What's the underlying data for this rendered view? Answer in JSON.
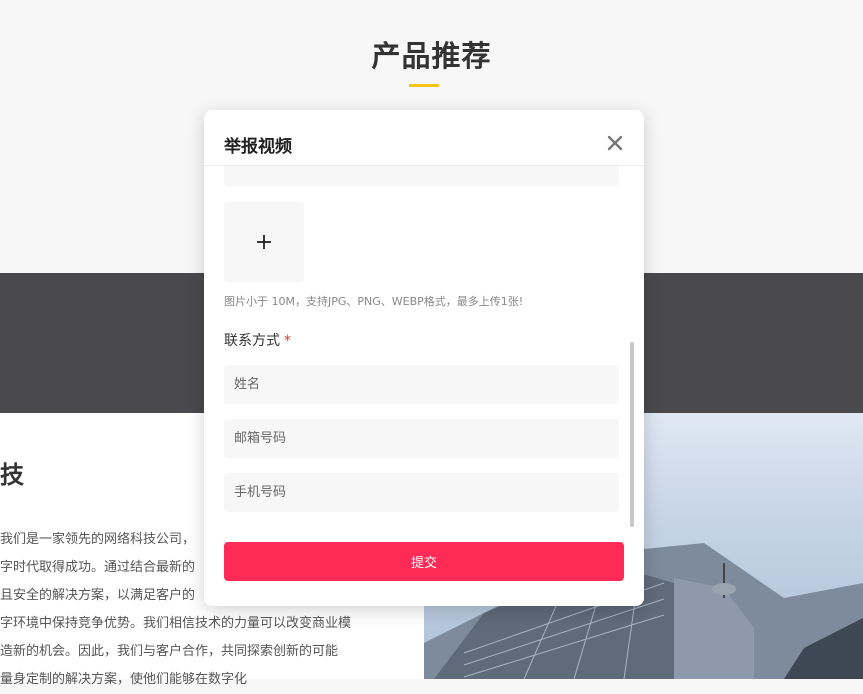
{
  "page": {
    "section_title": "产品推荐",
    "company_heading": "技",
    "company_lines": [
      "我们是一家领先的网络科技公司，",
      "字时代取得成功。通过结合最新的",
      "且安全的解决方案，以满足客户的",
      "字环境中保持竞争优势。我们相信技术的力量可以改变商业模",
      "造新的机会。因此，我们与客户合作，共同探索创新的可能",
      "量身定制的解决方案，使他们能够在数字化"
    ]
  },
  "modal": {
    "title": "举报视频",
    "close_icon": "close-icon",
    "upload_icon": "plus-icon",
    "upload_hint": "图片小于 10M，支持JPG、PNG、WEBP格式，最多上传1张!",
    "contact_label": "联系方式",
    "required_mark": "*",
    "fields": {
      "name_placeholder": "姓名",
      "email_placeholder": "邮箱号码",
      "phone_placeholder": "手机号码"
    },
    "submit_label": "提交"
  },
  "colors": {
    "accent_underline": "#f5c518",
    "submit_button": "#ff2a55",
    "required_star": "#e8334a",
    "dark_band": "#4a494e"
  }
}
